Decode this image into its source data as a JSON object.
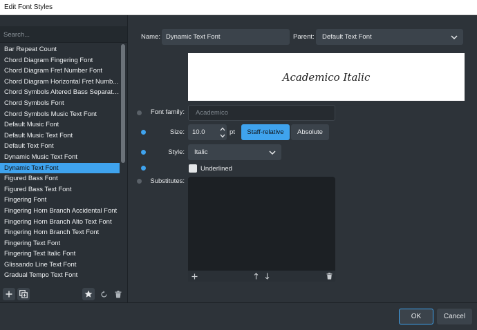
{
  "window": {
    "title": "Edit Font Styles"
  },
  "search": {
    "placeholder": "Search..."
  },
  "font_styles": [
    "Bar Repeat Count",
    "Chord Diagram Fingering Font",
    "Chord Diagram Fret Number Font",
    "Chord Diagram Horizontal Fret Numb...",
    "Chord Symbols Altered Bass Separator...",
    "Chord Symbols Font",
    "Chord Symbols Music Text Font",
    "Default Music Font",
    "Default Music Text Font",
    "Default Text Font",
    "Dynamic Music Text Font",
    "Dynamic Text Font",
    "Figured Bass Font",
    "Figured Bass Text Font",
    "Fingering Font",
    "Fingering Horn Branch Accidental Font",
    "Fingering Horn Branch Alto Text Font",
    "Fingering Horn Branch Text Font",
    "Fingering Text Font",
    "Fingering Text Italic Font",
    "Glissando Line Text Font",
    "Gradual Tempo Text Font"
  ],
  "selected_index": 11,
  "editor": {
    "name_label": "Name:",
    "name_value": "Dynamic Text Font",
    "parent_label": "Parent:",
    "parent_value": "Default Text Font",
    "preview_text": "Academico Italic",
    "font_family_label": "Font family:",
    "font_family_value": "Academico",
    "size_label": "Size:",
    "size_value": "10.0",
    "size_unit": "pt",
    "staff_relative_label": "Staff-relative",
    "absolute_label": "Absolute",
    "style_label": "Style:",
    "style_value": "Italic",
    "underlined_label": "Underlined",
    "underlined_checked": false,
    "substitutes_label": "Substitutes:"
  },
  "footer": {
    "ok_label": "OK",
    "cancel_label": "Cancel"
  },
  "colors": {
    "accent": "#3fa3ee",
    "panel": "#2a3036",
    "field": "#3b434b",
    "background": "#2d3339"
  }
}
